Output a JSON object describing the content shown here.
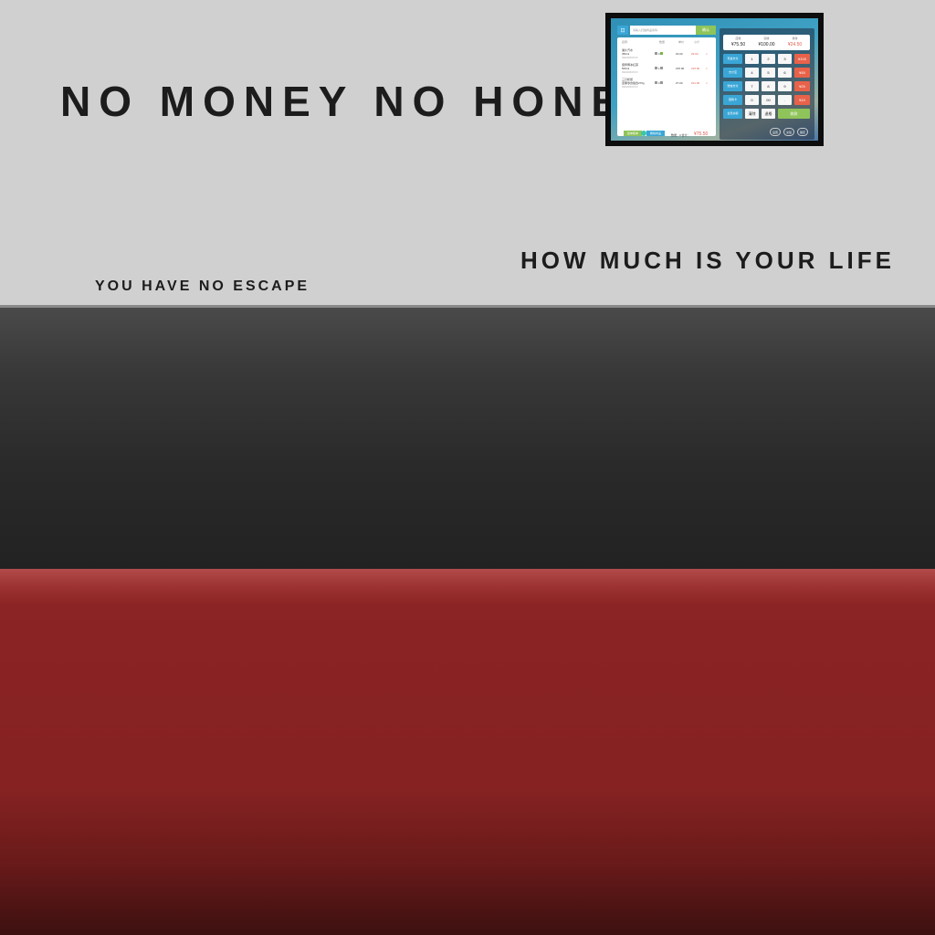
{
  "wall": {
    "headline": "NO MONEY NO HONEY",
    "tagline": "HOW MUCH IS YOUR LIFE",
    "subline": "YOU HAVE NO ESCAPE"
  },
  "pos": {
    "scan_icon": "scan-icon",
    "search_placeholder": "请输入扫描商品条码",
    "search_button": "确认",
    "columns": [
      "名称",
      "数量",
      "单价",
      "小计"
    ],
    "items": [
      {
        "name": "薯片汽水",
        "spec": "350ml",
        "code": "6902083XXX",
        "qty": "3",
        "price": "¥3.00",
        "subtotal": "¥9.00"
      },
      {
        "name": "康师傅冰红茶",
        "spec": "500ml",
        "code": "6902083XXX",
        "qty": "1",
        "price": "¥15.00",
        "subtotal": "¥15.00"
      },
      {
        "name": "三只松鼠",
        "spec": "坚果零食组合270g",
        "code": "6902083XXX",
        "qty": "3",
        "price": "¥7.00",
        "subtotal": "¥21.00"
      }
    ],
    "footer_green": "挂单取单",
    "footer_blue": "删除商品",
    "count_label": "数量：3  合计：",
    "total": "¥75.50",
    "summary": [
      {
        "label": "应收",
        "value": "¥75.50"
      },
      {
        "label": "实收",
        "value": "¥100.00"
      },
      {
        "label": "找零",
        "value": "¥24.50"
      }
    ],
    "side_buttons": [
      "现金支付",
      "支付宝",
      "微信支付",
      "银联卡",
      "会员余额"
    ],
    "keypad": [
      [
        "1",
        "2",
        "3"
      ],
      [
        "4",
        "5",
        "6"
      ],
      [
        "7",
        "8",
        "9"
      ],
      [
        "0",
        "00",
        "."
      ]
    ],
    "quick_amounts": [
      "¥100",
      "¥50",
      "¥20",
      "¥10"
    ],
    "bottom_keys": [
      "清除",
      "退格"
    ],
    "confirm": "收款",
    "round_buttons": [
      "设置",
      "交班",
      "锁定"
    ]
  }
}
